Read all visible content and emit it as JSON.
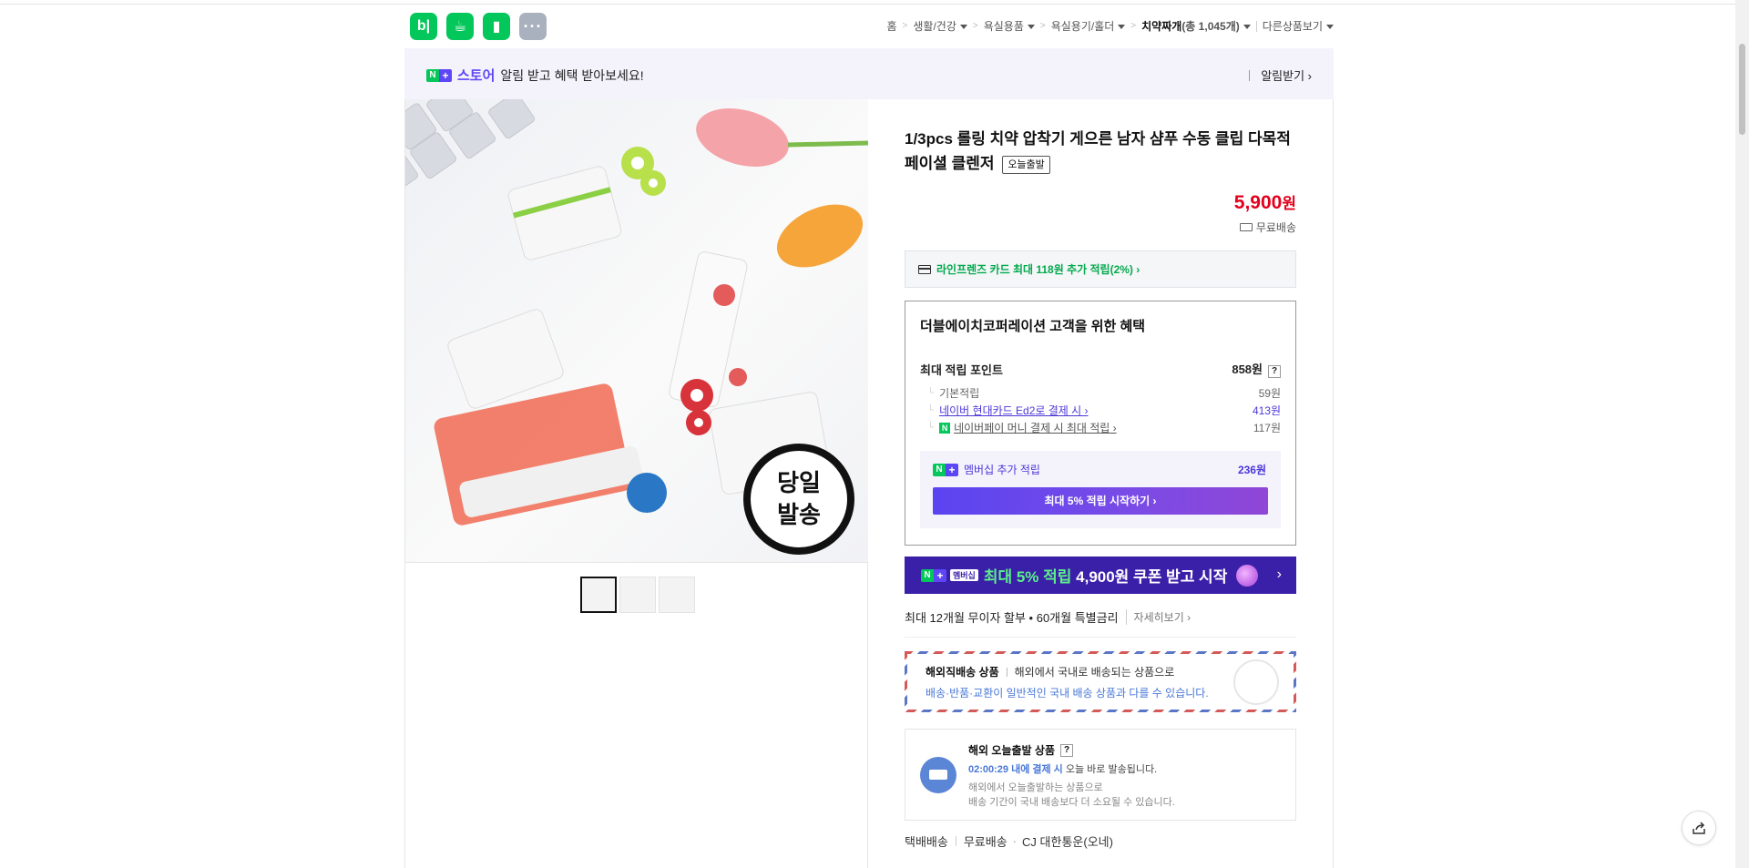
{
  "apps": [
    {
      "name": "blog",
      "glyph": "b|"
    },
    {
      "name": "cafe",
      "glyph": "☕"
    },
    {
      "name": "bookmark",
      "glyph": "▮"
    },
    {
      "name": "more",
      "glyph": "···"
    }
  ],
  "breadcrumb": {
    "home": "홈",
    "items": [
      "생활/건강",
      "욕실용품",
      "욕실용기/홀더"
    ],
    "current": "치약짜개",
    "count": "(총 1,045개)",
    "other": "다른상품보기"
  },
  "store_banner": {
    "store_name": "스토어",
    "message": "알림 받고 혜택 받아보세요!",
    "notify": "알림받기 ›"
  },
  "product": {
    "title": "1/3pcs 롤링 치약 압착기 게으른 남자 샴푸 수동 클립 다목적 페이셜 클렌저",
    "tag": "오늘출발",
    "price": "5,900",
    "price_unit": "원",
    "shipping": "무료배송",
    "image_badge_line1": "당일",
    "image_badge_line2": "발송"
  },
  "card_offer": "라인프렌즈 카드 최대 118원 추가 적립(2%) ›",
  "benefit": {
    "heading": "더블에이치코퍼레이션 고객을 위한 혜택",
    "max_points_label": "최대 적립 포인트",
    "max_points_value": "858원",
    "rows": [
      {
        "label": "기본적립",
        "value": "59원"
      },
      {
        "label": "네이버 현대카드 Ed2로 결제 시 ›",
        "value": "413원"
      },
      {
        "label": "네이버페이 머니 결제 시 최대 적립 ›",
        "value": "117원"
      }
    ],
    "membership_label": "멤버십 추가 적립",
    "membership_value": "236원",
    "membership_button": "최대 5% 적립 시작하기 ›"
  },
  "promo": {
    "badge": "멤버십",
    "highlight": "최대 5% 적립",
    "rest": " 4,900원 쿠폰 받고 시작",
    "arrow": "›"
  },
  "installment": {
    "text": "최대 12개월 무이자 할부 • 60개월 특별금리",
    "more": "자세히보기 ›"
  },
  "overseas": {
    "title": "해외직배송 상품",
    "desc": "해외에서 국내로 배송되는 상품으로",
    "note": "배송·반품·교환이 일반적인 국내 배송 상품과 다를 수 있습니다."
  },
  "delivery": {
    "title": "해외 오늘출발 상품",
    "countdown": "02:00:29 내에 결제 시",
    "countdown_rest": " 오늘 바로 발송됩니다.",
    "note1": "해외에서 오늘출발하는 상품으로",
    "note2": "배송 기간이 국내 배송보다 더 소요될 수 있습니다."
  },
  "carrier": {
    "type": "택배배송",
    "fee": "무료배송",
    "company": "CJ 대한통운(오네)"
  }
}
